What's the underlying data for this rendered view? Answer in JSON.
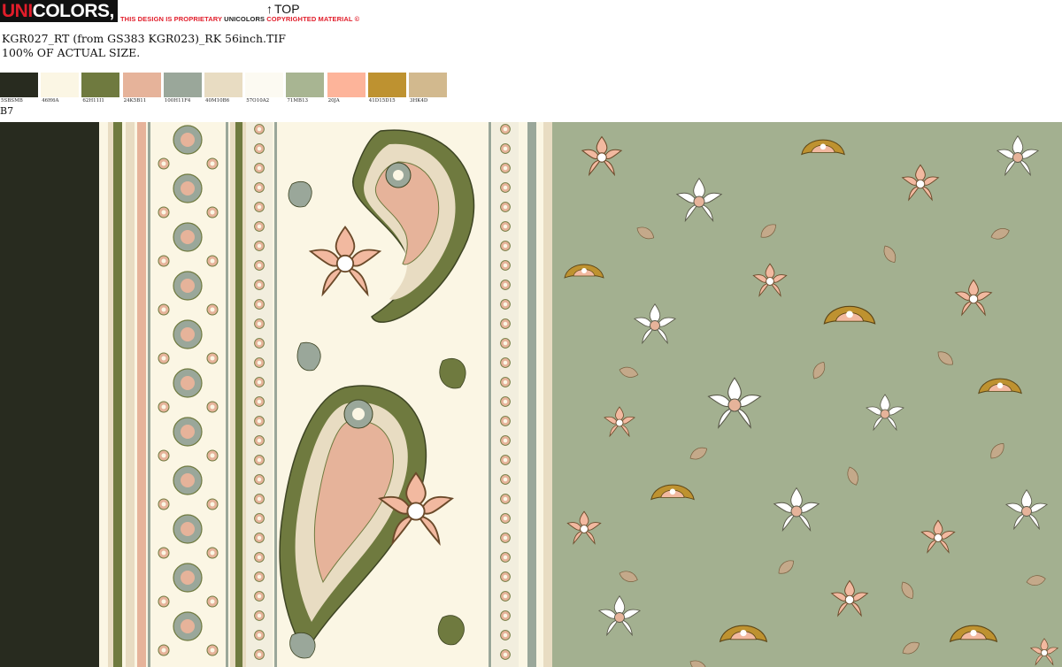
{
  "header": {
    "logo_prefix": "UNI",
    "logo_rest": "COLORS, INC.",
    "notice_part1": "THIS DESIGN IS PROPRIETARY ",
    "notice_brand": "UNICOLORS",
    "notice_part2": " COPYRIGHTED MATERIAL ©",
    "top_arrow": "↑",
    "top_label": "TOP",
    "filename": "KGR027_RT (from GS383 KGR023)_RK 56inch.TIF",
    "scale_note": "100% OF ACTUAL SIZE.",
    "bcode": "B7"
  },
  "palette": [
    {
      "code": "5SBSMB",
      "color": "#282b1f"
    },
    {
      "code": "46H6A",
      "color": "#fbf6e4"
    },
    {
      "code": "62H11I1",
      "color": "#6f7a3f"
    },
    {
      "code": "24K5B11",
      "color": "#e6b39a"
    },
    {
      "code": "100H11F4",
      "color": "#9aa79a"
    },
    {
      "code": "40M10B6",
      "color": "#e8dcc2"
    },
    {
      "code": "57O10A2",
      "color": "#fcfaf2"
    },
    {
      "code": "71MB13",
      "color": "#a8b592"
    },
    {
      "code": "20JA",
      "color": "#fdb49a"
    },
    {
      "code": "41D15D15",
      "color": "#be9230"
    },
    {
      "code": "3HK4D",
      "color": "#d2b98e"
    }
  ],
  "colors": {
    "dark": "#282b1f",
    "olive": "#6f7a3f",
    "sage": "#9aa79a",
    "cream": "#fbf6e4",
    "beige": "#e8dcc2",
    "blush": "#e6b39a",
    "field": "#a3b090",
    "gold": "#be9230",
    "tan": "#d2b98e"
  }
}
